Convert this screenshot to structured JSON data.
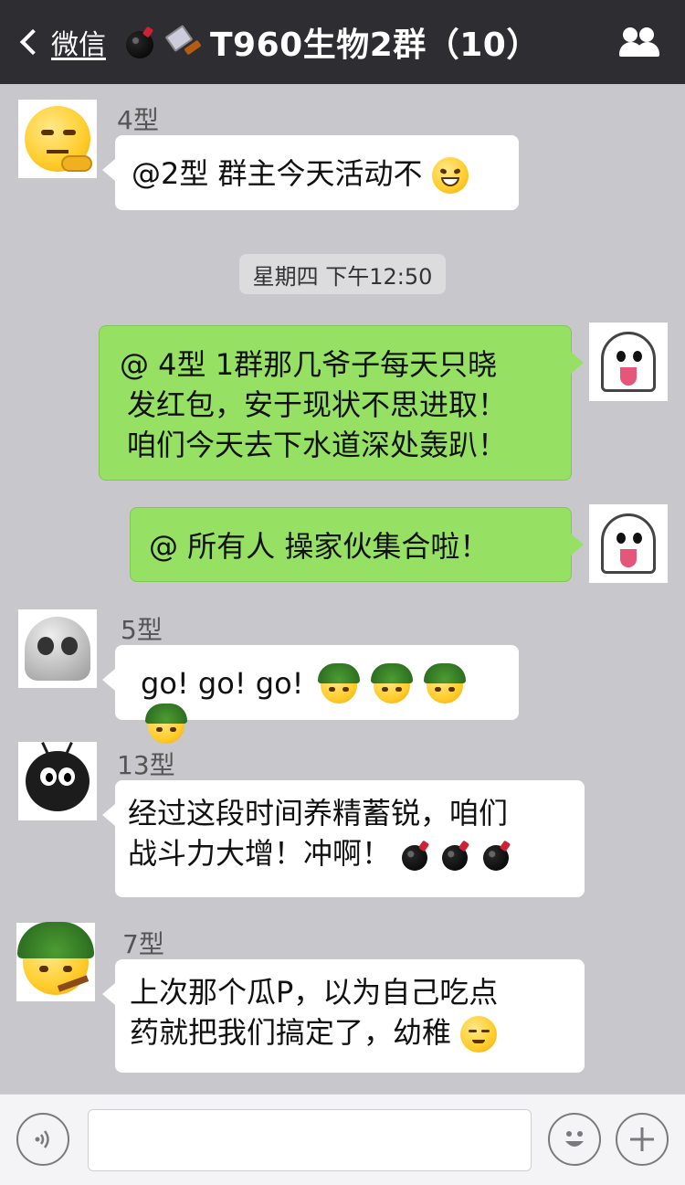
{
  "header": {
    "back_label": "微信",
    "title": "T960生物2群（10）",
    "title_icons": [
      "bomb-icon",
      "knife-icon"
    ],
    "right_icon": "group-members-icon"
  },
  "messages": [
    {
      "sender": "4型",
      "text": "@2型 群主今天活动不",
      "emoji": "grin-squint-face"
    },
    {
      "timestamp": "星期四 下午12:50"
    },
    {
      "sender_self": true,
      "lines": [
        "@ 4型 1群那几爷子每天只晓",
        "发红包，安于现状不思进取！",
        "咱们今天去下水道深处轰趴！"
      ]
    },
    {
      "sender_self": true,
      "text": "@ 所有人 操家伙集合啦！"
    },
    {
      "sender": "5型",
      "text": "go! go! go!",
      "emoji": "helmet-cigar-face x4"
    },
    {
      "sender": "13型",
      "lines": [
        "经过这段时间养精蓄锐，咱们",
        "战斗力大增！冲啊！"
      ],
      "emoji": "bomb x3"
    },
    {
      "sender": "7型",
      "lines": [
        "上次那个瓜P，以为自己吃点",
        "药就把我们搞定了，幼稚"
      ],
      "emoji": "smug-face"
    }
  ],
  "input": {
    "placeholder": ""
  },
  "colors": {
    "header_bg": "#2e2e32",
    "chat_bg": "#c8c8cc",
    "self_bubble": "#96e064"
  }
}
